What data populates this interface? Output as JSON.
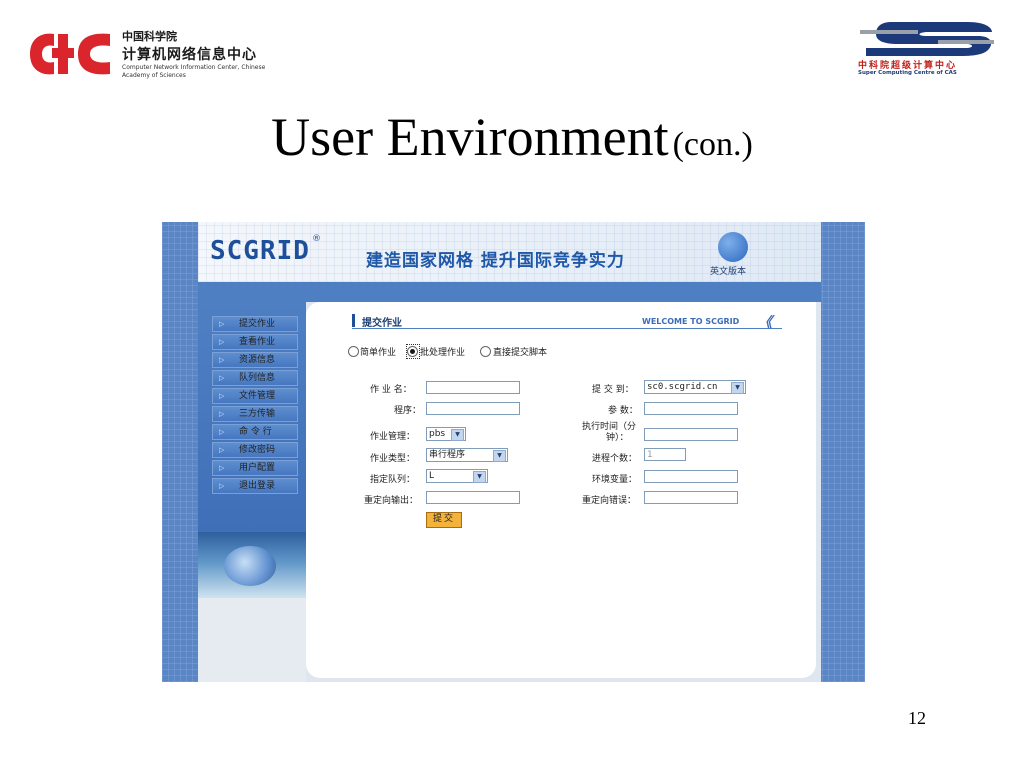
{
  "slide": {
    "title": "User Environment",
    "title_suffix": "(con.)",
    "page_number": "12"
  },
  "logos": {
    "cnic": {
      "name_cn_line1": "中国科学院",
      "name_cn_line2": "计算机网络信息中心",
      "name_en": "Computer Network Information Center, Chinese Academy of Sciences",
      "colors": {
        "mark": "#d9252b"
      }
    },
    "sccas": {
      "name_cn": "中科院超级计算中心",
      "name_en": "Super Computing Centre of CAS",
      "colors": {
        "blue": "#1c3a7a",
        "gray": "#9aa0aa"
      }
    }
  },
  "app": {
    "brand": "SCGRID",
    "brand_reg": "®",
    "slogan": "建造国家网格  提升国际竞争实力",
    "english_link": "英文版本",
    "colors": {
      "primary": "#4f7fc3",
      "submit": "#f3b23a"
    }
  },
  "sidebar": {
    "items": [
      {
        "label": "提交作业"
      },
      {
        "label": "查看作业"
      },
      {
        "label": "资源信息"
      },
      {
        "label": "队列信息"
      },
      {
        "label": "文件管理"
      },
      {
        "label": "三方传输"
      },
      {
        "label": "命 令 行"
      },
      {
        "label": "修改密码"
      },
      {
        "label": "用户配置"
      },
      {
        "label": "退出登录"
      }
    ]
  },
  "content": {
    "title": "提交作业",
    "welcome": "WELCOME TO SCGRID",
    "chevron": "《",
    "job_modes": [
      {
        "label": "简单作业",
        "checked": false
      },
      {
        "label": "批处理作业",
        "checked": true
      },
      {
        "label": "直接提交脚本",
        "checked": false
      }
    ],
    "form_left": {
      "job_name_label": "作 业 名：",
      "job_name_value": "",
      "program_label": "程序：",
      "program_value": "",
      "job_manager_label": "作业管理：",
      "job_manager_value": "pbs",
      "job_type_label": "作业类型：",
      "job_type_value": "串行程序",
      "queue_label": "指定队列：",
      "queue_value": "L",
      "stdout_label": "重定向输出：",
      "stdout_value": ""
    },
    "form_right": {
      "submit_to_label": "提 交 到：",
      "submit_to_value": "sc0.scgrid.cn",
      "params_label": "参 数：",
      "params_value": "",
      "exec_time_label_1": "执行时间（分",
      "exec_time_label_2": "钟）：",
      "exec_time_value": "",
      "processes_label": "进程个数：",
      "processes_value": "1",
      "env_label": "环境变量：",
      "env_value": "",
      "stderr_label": "重定向错误：",
      "stderr_value": ""
    },
    "submit_label": "提交"
  }
}
